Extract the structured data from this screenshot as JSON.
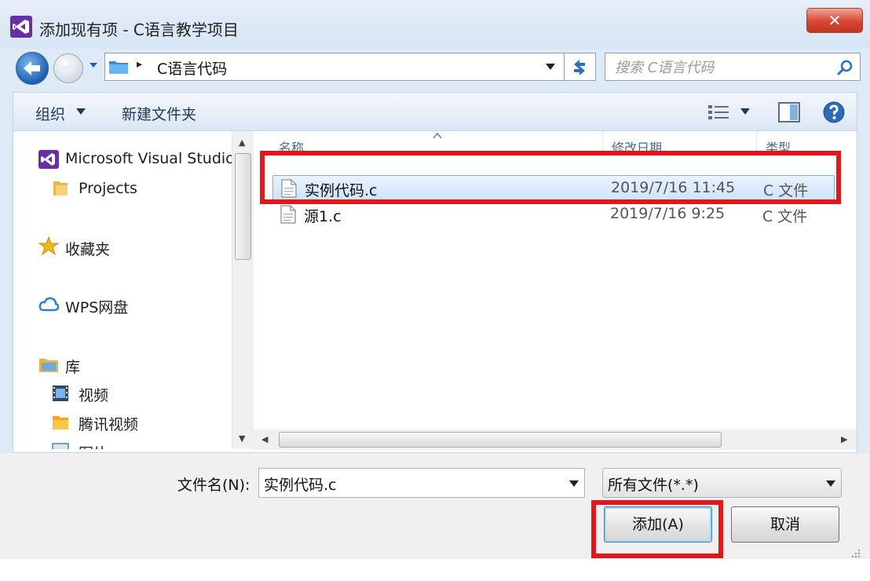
{
  "window": {
    "title": "添加现有项 - C语言教学项目",
    "close_label": "✕"
  },
  "address": {
    "separator": "▸",
    "path": "C语言代码"
  },
  "search": {
    "placeholder": "搜索 C语言代码"
  },
  "toolbar": {
    "organize_label": "组织",
    "new_folder_label": "新建文件夹"
  },
  "nav": {
    "items": [
      {
        "label": "Microsoft Visual Studio",
        "icon": "visual-studio-icon"
      },
      {
        "label": "Projects",
        "icon": "folder-icon"
      },
      {
        "label": "收藏夹",
        "icon": "star-icon"
      },
      {
        "label": "WPS网盘",
        "icon": "cloud-icon"
      },
      {
        "label": "库",
        "icon": "library-icon"
      },
      {
        "label": "视频",
        "icon": "video-icon"
      },
      {
        "label": "腾讯视频",
        "icon": "folder-icon"
      },
      {
        "label": "图片",
        "icon": "picture-icon"
      }
    ]
  },
  "files": {
    "columns": {
      "name": "名称",
      "date": "修改日期",
      "type": "类型"
    },
    "rows": [
      {
        "name": "实例代码.c",
        "date": "2019/7/16 11:45",
        "type": "C 文件",
        "selected": true
      },
      {
        "name": "源1.c",
        "date": "2019/7/16 9:25",
        "type": "C 文件",
        "selected": false
      }
    ]
  },
  "footer": {
    "filename_label": "文件名(N):",
    "filename_value": "实例代码.c",
    "filter_value": "所有文件(*.*)",
    "add_button": "添加(A)",
    "cancel_button": "取消"
  },
  "colors": {
    "highlight": "#e3161b",
    "accent": "#3c7fb1",
    "vs_purple": "#6a2ea4"
  }
}
